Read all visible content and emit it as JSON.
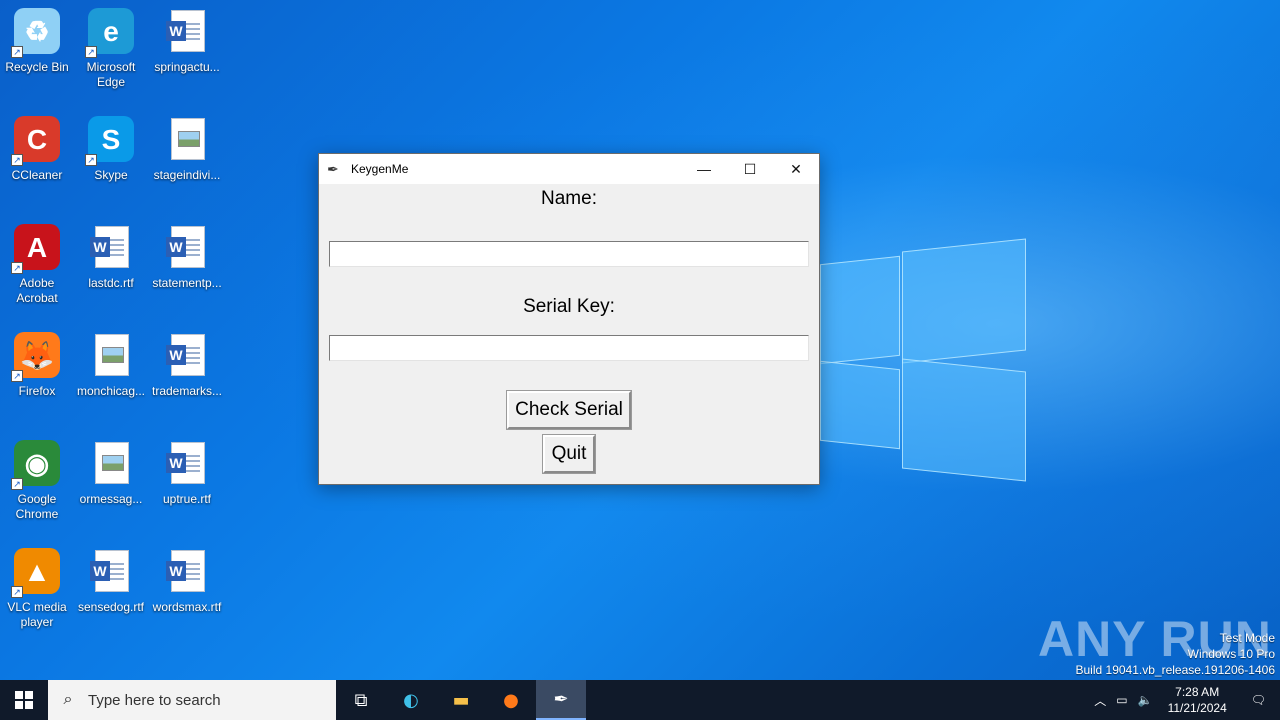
{
  "desktop": {
    "icons": [
      {
        "label": "Recycle Bin",
        "glyph": "♻",
        "color": "#8fd0f5",
        "type": "app"
      },
      {
        "label": "Microsoft Edge",
        "glyph": "e",
        "color": "#1d9ad6",
        "type": "app"
      },
      {
        "label": "springactu...",
        "type": "word"
      },
      {
        "label": "CCleaner",
        "glyph": "C",
        "color": "#d93a2a",
        "type": "app"
      },
      {
        "label": "Skype",
        "glyph": "S",
        "color": "#0a9ae8",
        "type": "app"
      },
      {
        "label": "stageindivi...",
        "type": "image"
      },
      {
        "label": "Adobe Acrobat",
        "glyph": "A",
        "color": "#c8131b",
        "type": "app"
      },
      {
        "label": "lastdc.rtf",
        "type": "word"
      },
      {
        "label": "statementp...",
        "type": "word"
      },
      {
        "label": "Firefox",
        "glyph": "🦊",
        "color": "#ff7a1a",
        "type": "app"
      },
      {
        "label": "monchicag...",
        "type": "image"
      },
      {
        "label": "trademarks...",
        "type": "word"
      },
      {
        "label": "Google Chrome",
        "glyph": "◉",
        "color": "#2a8a3a",
        "type": "app"
      },
      {
        "label": "ormessag...",
        "type": "image"
      },
      {
        "label": "uptrue.rtf",
        "type": "word"
      },
      {
        "label": "VLC media player",
        "glyph": "▲",
        "color": "#f08a00",
        "type": "app"
      },
      {
        "label": "sensedog.rtf",
        "type": "word"
      },
      {
        "label": "wordsmax.rtf",
        "type": "word"
      }
    ]
  },
  "window": {
    "title": "KeygenMe",
    "name_label": "Name:",
    "name_value": "",
    "serial_label": "Serial Key:",
    "serial_value": "",
    "check_button": "Check Serial",
    "quit_button": "Quit"
  },
  "watermark": "ANY RUN",
  "sysinfo": {
    "line1": "Test Mode",
    "line2": "Windows 10 Pro",
    "line3": "Build 19041.vb_release.191206-1406"
  },
  "taskbar": {
    "search_placeholder": "Type here to search",
    "time": "7:28 AM",
    "date": "11/21/2024"
  }
}
